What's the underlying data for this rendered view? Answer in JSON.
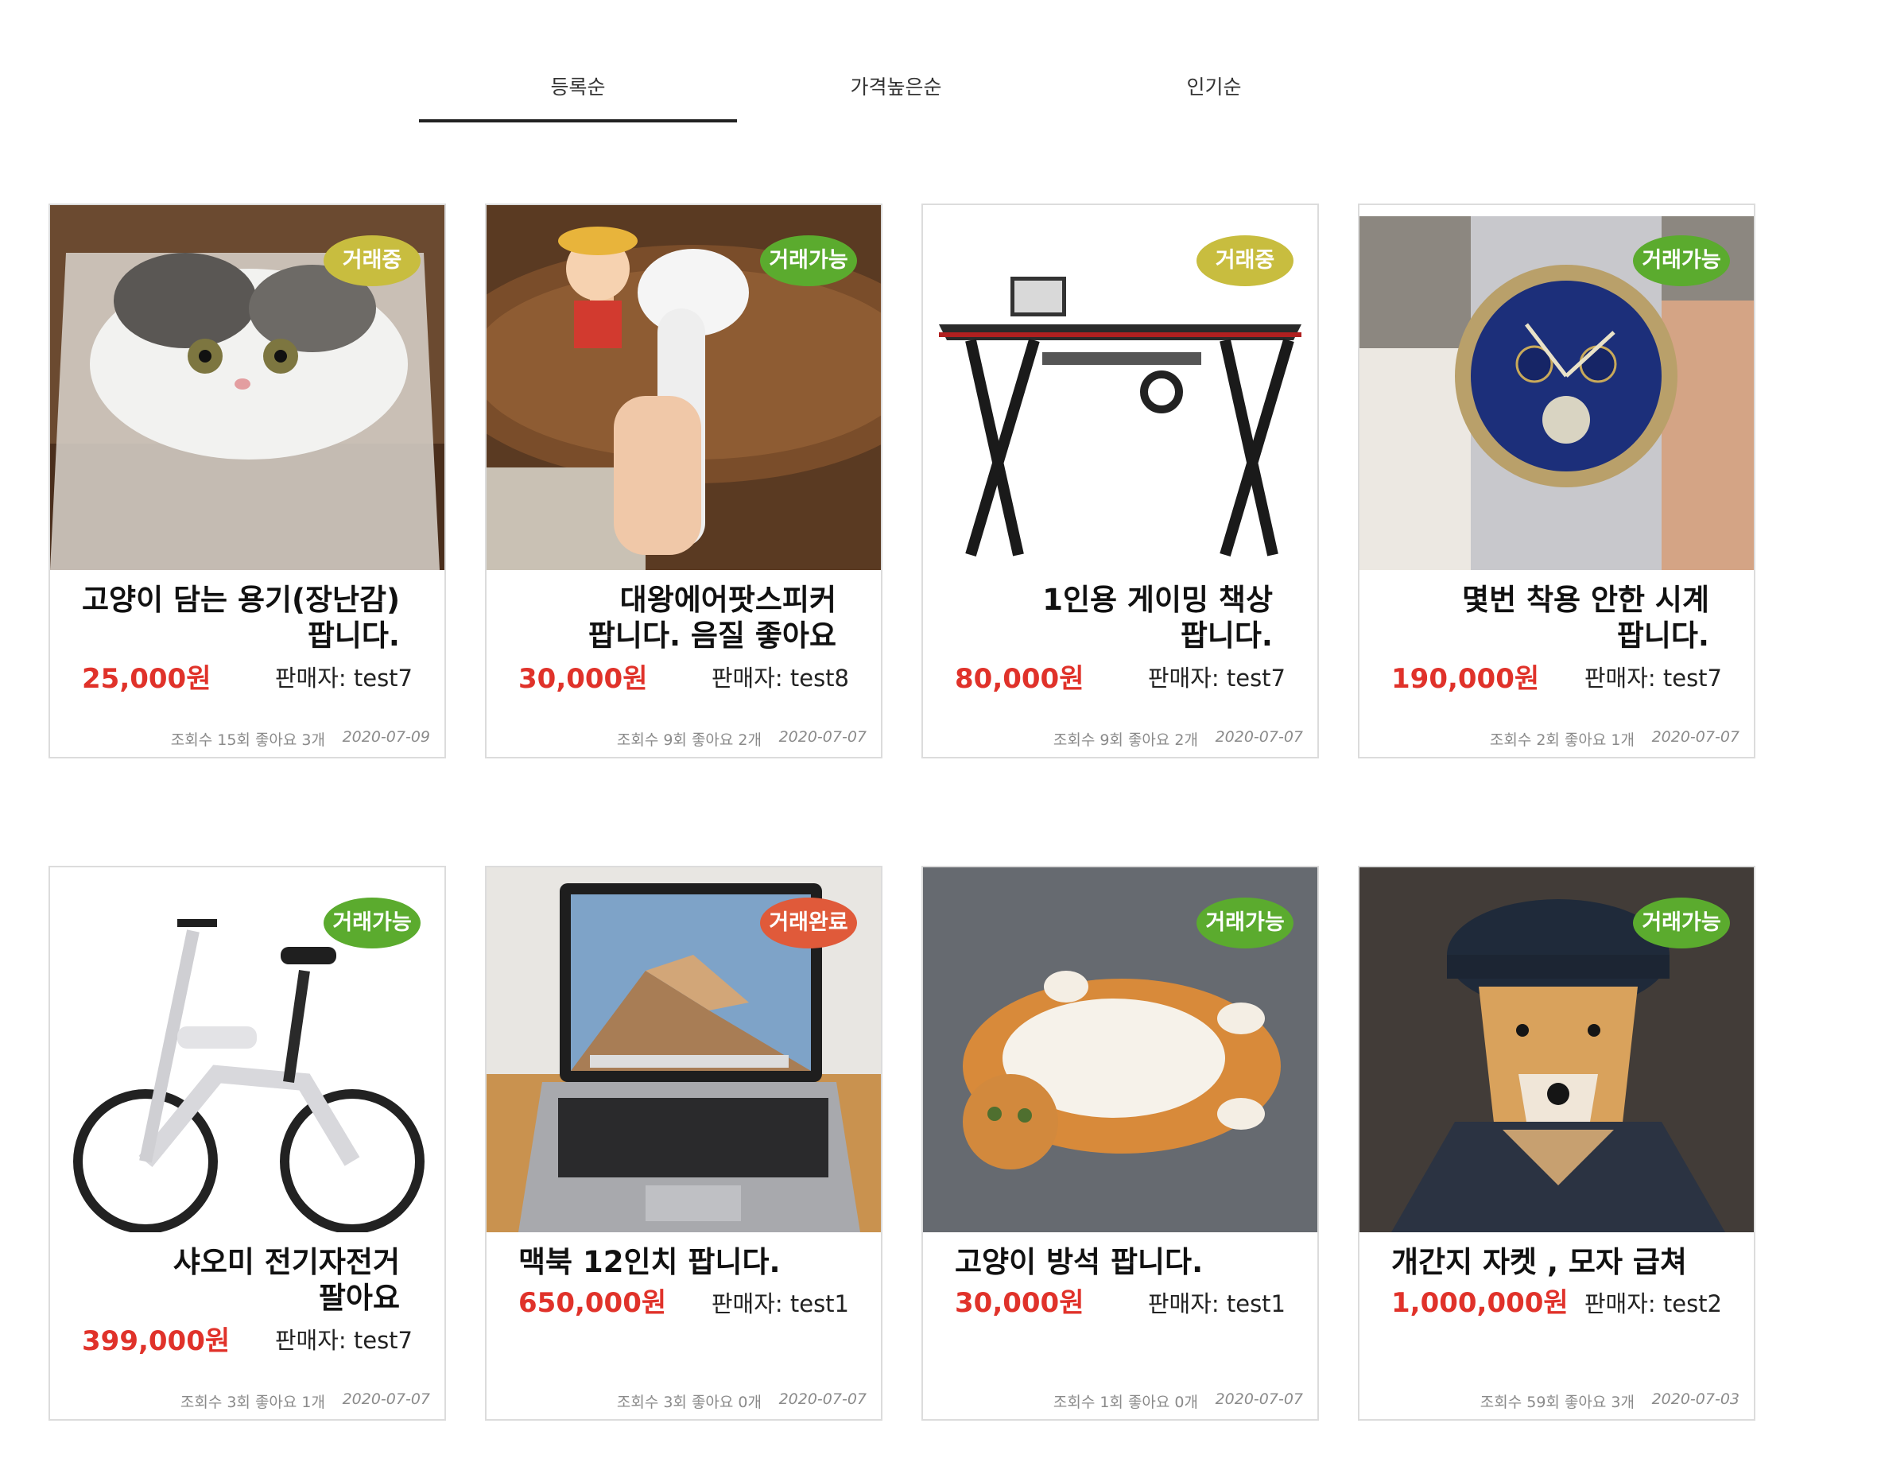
{
  "tabs": [
    {
      "label": "등록순",
      "active": true
    },
    {
      "label": "가격높은순",
      "active": false
    },
    {
      "label": "인기순",
      "active": false
    }
  ],
  "colors": {
    "badge_trading": "#c8bd3f",
    "badge_available": "#5bab2e",
    "badge_done": "#e05a3a",
    "price": "#e0322a"
  },
  "products": [
    {
      "image": "cat-in-box-photo",
      "status": "거래중",
      "title": "고양이 담는 용기(장난감) 팝니다.",
      "price": "25,000원",
      "seller": "판매자: test7",
      "stats": "조회수 15회 좋아요 3개",
      "date": "2020-07-09"
    },
    {
      "image": "giant-earbud-speaker-photo",
      "status": "거래가능",
      "title": "대왕에어팟스피커 팝니다. 음질 좋아요",
      "price": "30,000원",
      "seller": "판매자: test8",
      "stats": "조회수 9회 좋아요 2개",
      "date": "2020-07-07"
    },
    {
      "image": "gaming-desk-photo",
      "status": "거래중",
      "title": "1인용 게이밍 책상 팝니다.",
      "price": "80,000원",
      "seller": "판매자: test7",
      "stats": "조회수 9회 좋아요 2개",
      "date": "2020-07-07"
    },
    {
      "image": "wrist-watch-photo",
      "status": "거래가능",
      "title": "몇번 착용 안한 시계 팝니다.",
      "price": "190,000원",
      "seller": "판매자: test7",
      "stats": "조회수 2회 좋아요 1개",
      "date": "2020-07-07"
    },
    {
      "image": "electric-bicycle-photo",
      "status": "거래가능",
      "title": "샤오미 전기자전거 팔아요",
      "price": "399,000원",
      "seller": "판매자: test7",
      "stats": "조회수 3회 좋아요 1개",
      "date": "2020-07-07"
    },
    {
      "image": "macbook-laptop-photo",
      "status": "거래완료",
      "title": "맥북 12인치 팝니다.",
      "price": "650,000원",
      "seller": "판매자: test1",
      "stats": "조회수 3회 좋아요 0개",
      "date": "2020-07-07"
    },
    {
      "image": "lying-cat-photo",
      "status": "거래가능",
      "title": "고양이 방석 팝니다.",
      "price": "30,000원",
      "seller": "판매자: test1",
      "stats": "조회수 1회 좋아요 0개",
      "date": "2020-07-07"
    },
    {
      "image": "dog-in-jacket-photo",
      "status": "거래가능",
      "title": "개간지 자켓 , 모자 급쳐",
      "price": "1,000,000원",
      "seller": "판매자: test2",
      "stats": "조회수 59회 좋아요 3개",
      "date": "2020-07-03"
    }
  ]
}
